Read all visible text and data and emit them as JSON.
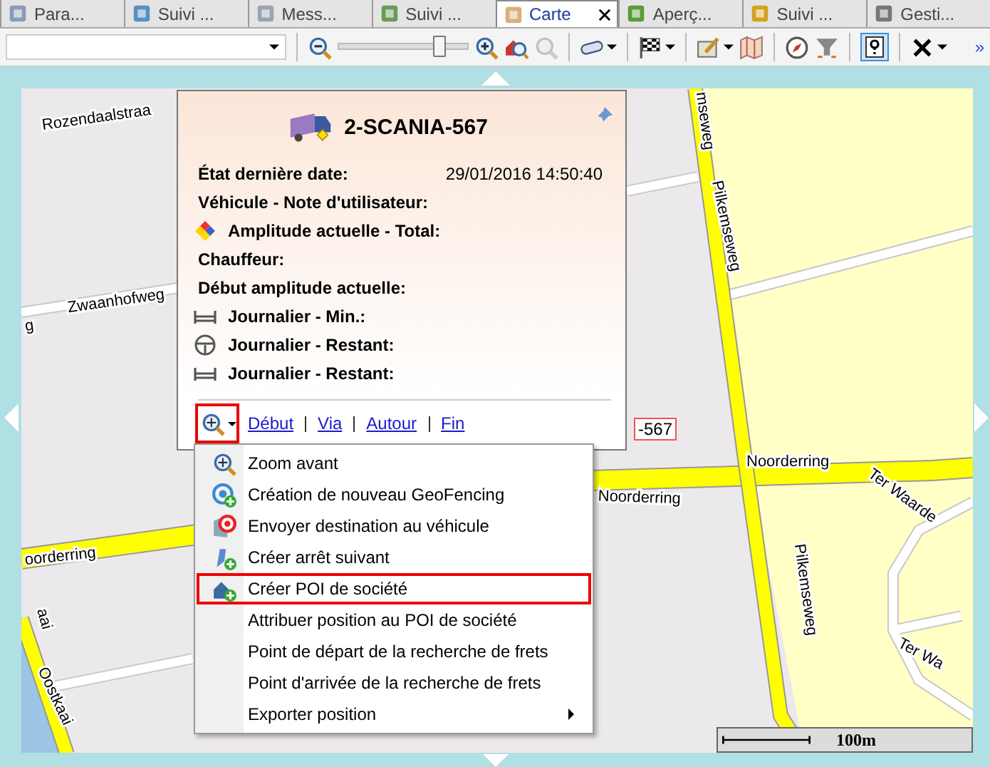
{
  "tabs": [
    {
      "label": "Para...",
      "selected": false
    },
    {
      "label": "Suivi ...",
      "selected": false
    },
    {
      "label": "Mess...",
      "selected": false
    },
    {
      "label": "Suivi ...",
      "selected": false
    },
    {
      "label": "Carte",
      "selected": true
    },
    {
      "label": "Aperç...",
      "selected": false
    },
    {
      "label": "Suivi ...",
      "selected": false
    },
    {
      "label": "Gesti...",
      "selected": false
    }
  ],
  "toolbar": {
    "zoom_slider": {
      "level": 0.8
    },
    "help_toggle": {
      "on": true
    },
    "overflow": "»"
  },
  "map": {
    "street_labels": [
      {
        "text": "Rozendaalstraa"
      },
      {
        "text": "Zwaanhofweg"
      },
      {
        "text": "g"
      },
      {
        "text": "oorderring"
      },
      {
        "text": "Noorderring"
      },
      {
        "text": "Noorderring"
      },
      {
        "text": "mseweg"
      },
      {
        "text": "Pilkemseweg"
      },
      {
        "text": "Pilkemseweg"
      },
      {
        "text": "Ter Waarde"
      },
      {
        "text": "Ter Wa"
      },
      {
        "text": "Oostkaai"
      },
      {
        "text": "aai"
      }
    ],
    "vehicle_label": "-567",
    "scale": "100m"
  },
  "popup": {
    "title": "2-SCANIA-567",
    "rows": [
      {
        "label": "État dernière date:",
        "value": "29/01/2016 14:50:40",
        "kind": "plain"
      },
      {
        "label": "Véhicule - Note d'utilisateur:",
        "kind": "plain"
      },
      {
        "label": "Amplitude actuelle - Total:",
        "kind": "amplitude"
      },
      {
        "label": "Chauffeur:",
        "kind": "plain"
      },
      {
        "label": "Début amplitude actuelle:",
        "kind": "plain"
      },
      {
        "label": "Journalier - Min.:",
        "kind": "rest"
      },
      {
        "label": "Journalier - Restant:",
        "kind": "driving"
      },
      {
        "label": "Journalier - Restant:",
        "kind": "rest"
      }
    ],
    "links": [
      "Début",
      "Via",
      "Autour",
      "Fin"
    ]
  },
  "menu": {
    "items": [
      {
        "label": "Zoom avant",
        "kind": "zoom",
        "selected": false,
        "submenu": false
      },
      {
        "label": "Création de nouveau GeoFencing",
        "kind": "geofence",
        "selected": false,
        "submenu": false
      },
      {
        "label": "Envoyer destination au véhicule",
        "kind": "target",
        "selected": false,
        "submenu": false
      },
      {
        "label": "Créer arrêt suivant",
        "kind": "stop",
        "selected": false,
        "submenu": false
      },
      {
        "label": "Créer POI de société",
        "kind": "poi",
        "selected": true,
        "submenu": false
      },
      {
        "label": "Attribuer position au POI de société",
        "kind": "none",
        "selected": false,
        "submenu": false
      },
      {
        "label": "Point de départ de la recherche de frets",
        "kind": "none",
        "selected": false,
        "submenu": false
      },
      {
        "label": "Point d'arrivée de la recherche de frets",
        "kind": "none",
        "selected": false,
        "submenu": false
      },
      {
        "label": "Exporter position",
        "kind": "none",
        "selected": false,
        "submenu": true
      }
    ]
  }
}
